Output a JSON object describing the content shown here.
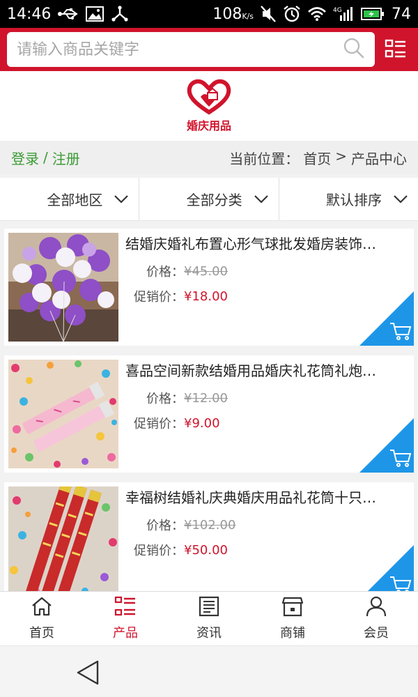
{
  "status_bar": {
    "time": "14:46",
    "network_speed": "108",
    "network_unit": "K/s",
    "signal_label": "4G",
    "battery": "74",
    "icons": [
      "usb-icon",
      "image-icon",
      "share-icon",
      "mute-icon",
      "alarm-icon",
      "wifi-icon",
      "signal-icon",
      "battery-icon"
    ]
  },
  "search": {
    "placeholder": "请输入商品关键字",
    "value": ""
  },
  "logo": {
    "text": "婚庆用品"
  },
  "info_row": {
    "login": "登录",
    "separator": "/",
    "register": "注册",
    "breadcrumb_label": "当前位置：",
    "breadcrumb_home": "首页",
    "breadcrumb_arrow": ">",
    "breadcrumb_current": "产品中心"
  },
  "filters": [
    {
      "label": "全部地区"
    },
    {
      "label": "全部分类"
    },
    {
      "label": "默认排序"
    }
  ],
  "products": [
    {
      "title": "结婚庆婚礼布置心形气球批发婚房装饰…",
      "price_label": "价格：",
      "price": "¥45.00",
      "promo_label": "促销价：",
      "promo_price": "¥18.00"
    },
    {
      "title": "喜品空间新款结婚用品婚庆礼花筒礼炮…",
      "price_label": "价格：",
      "price": "¥12.00",
      "promo_label": "促销价：",
      "promo_price": "¥9.00"
    },
    {
      "title": "幸福树结婚礼庆典婚庆用品礼花筒十只…",
      "price_label": "价格：",
      "price": "¥102.00",
      "promo_label": "促销价：",
      "promo_price": "¥50.00"
    }
  ],
  "bottom_nav": [
    {
      "label": "首页",
      "icon": "home-icon",
      "active": false
    },
    {
      "label": "产品",
      "icon": "list-icon",
      "active": true
    },
    {
      "label": "资讯",
      "icon": "news-icon",
      "active": false
    },
    {
      "label": "商铺",
      "icon": "shop-icon",
      "active": false
    },
    {
      "label": "会员",
      "icon": "user-icon",
      "active": false
    }
  ],
  "colors": {
    "brand_red": "#d0142c",
    "login_green": "#3a9b33",
    "cart_blue": "#1e96e8"
  }
}
